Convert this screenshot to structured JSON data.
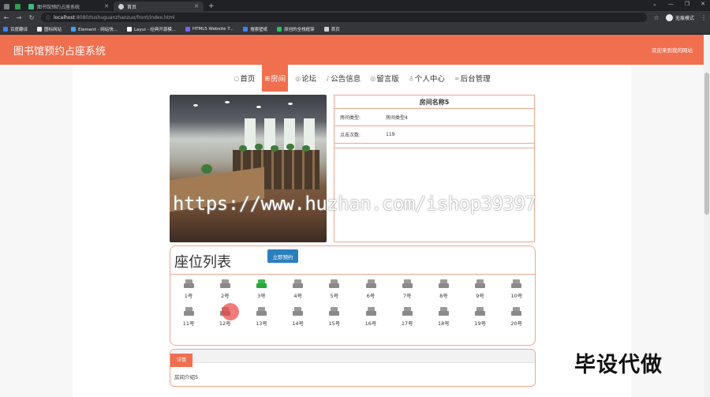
{
  "browser": {
    "tabs": [
      {
        "label": "",
        "color": "#7c7c7c"
      },
      {
        "label": "",
        "color": "#2e9e4f"
      },
      {
        "label": "图书馆预约占座系统",
        "color": "#41b883"
      },
      {
        "label": "首页",
        "color": "#cfcfcf"
      }
    ],
    "new_tab": "+",
    "url_host": "localhost",
    "url_path": ":8080/tushuguanzhanzuo/front/index.html",
    "profile_label": "无痕模式",
    "bookmarks": [
      {
        "label": "百度翻译",
        "color": "#3b82f6"
      },
      {
        "label": "图标网站",
        "color": "#e8eaed"
      },
      {
        "label": "Element - 网站快...",
        "color": "#409eff"
      },
      {
        "label": "Layui - 经典开源模...",
        "color": "#ffffff"
      },
      {
        "label": "HTML5 Website T...",
        "color": "#7b61ff"
      },
      {
        "label": "搜索壁纸",
        "color": "#3b82f6"
      },
      {
        "label": "原创的全栈框架",
        "color": "#22c55e"
      },
      {
        "label": "首页",
        "color": "#cfcfcf"
      }
    ]
  },
  "header": {
    "title": "图书馆预约占座系统",
    "welcome": "欢迎来到我的网站",
    "brand_color": "#ef6f4f"
  },
  "nav": {
    "items": [
      {
        "label": "首页",
        "icon": "home-icon",
        "glyph": "○",
        "active": false
      },
      {
        "label": "房间",
        "icon": "room-icon",
        "glyph": "⊞",
        "active": true
      },
      {
        "label": "论坛",
        "icon": "forum-icon",
        "glyph": "◎",
        "active": false
      },
      {
        "label": "公告信息",
        "icon": "notice-icon",
        "glyph": "♪",
        "active": false
      },
      {
        "label": "留言版",
        "icon": "message-icon",
        "glyph": "◎",
        "active": false
      },
      {
        "label": "个人中心",
        "icon": "user-icon",
        "glyph": "♙",
        "active": false
      },
      {
        "label": "后台管理",
        "icon": "link-icon",
        "glyph": "∞",
        "active": false
      }
    ]
  },
  "room": {
    "name": "房间名称5",
    "type_label": "房间类型:",
    "type_value": "房间类型4",
    "clicks_label": "点击次数:",
    "clicks_value": "119"
  },
  "watermark": "https://www.huzhan.com/ishop39397",
  "seats": {
    "heading": "座位列表",
    "reserve_button": "立即预约",
    "items": [
      {
        "label": "1号",
        "booked": false
      },
      {
        "label": "2号",
        "booked": false
      },
      {
        "label": "3号",
        "booked": true
      },
      {
        "label": "4号",
        "booked": false
      },
      {
        "label": "5号",
        "booked": false
      },
      {
        "label": "6号",
        "booked": false
      },
      {
        "label": "7号",
        "booked": false
      },
      {
        "label": "8号",
        "booked": false
      },
      {
        "label": "9号",
        "booked": false
      },
      {
        "label": "10号",
        "booked": false
      },
      {
        "label": "11号",
        "booked": false
      },
      {
        "label": "12号",
        "booked": false
      },
      {
        "label": "13号",
        "booked": false
      },
      {
        "label": "14号",
        "booked": false
      },
      {
        "label": "15号",
        "booked": false
      },
      {
        "label": "16号",
        "booked": false
      },
      {
        "label": "17号",
        "booked": false
      },
      {
        "label": "18号",
        "booked": false
      },
      {
        "label": "19号",
        "booked": false
      },
      {
        "label": "20号",
        "booked": false
      }
    ]
  },
  "detail": {
    "tab_label": "详情",
    "body": "房间介绍5"
  },
  "promo": "毕设代做"
}
